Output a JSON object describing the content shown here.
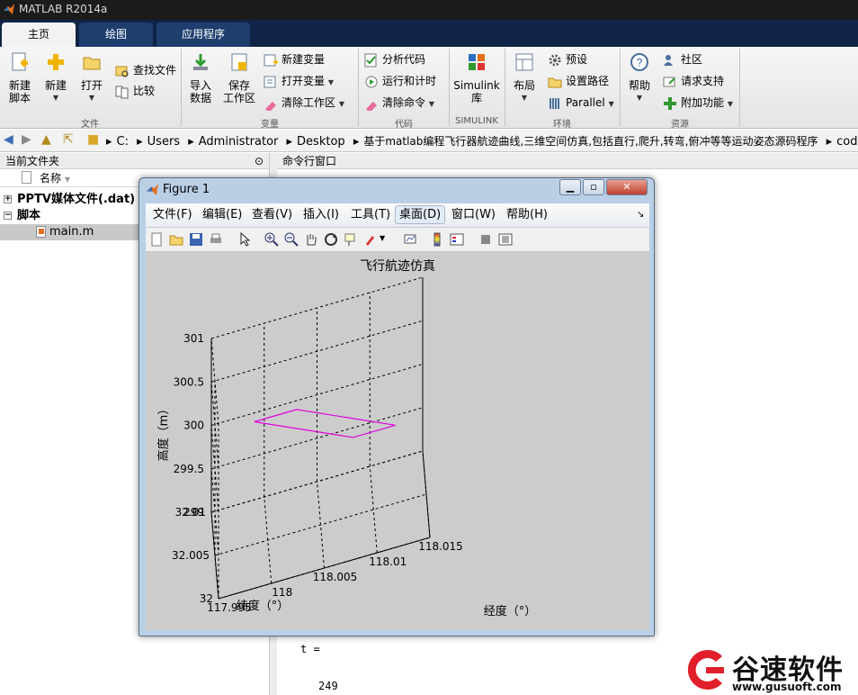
{
  "app": {
    "title": "MATLAB R2014a"
  },
  "tabs": [
    {
      "label": "主页"
    },
    {
      "label": "绘图"
    },
    {
      "label": "应用程序"
    }
  ],
  "ribbon": {
    "file": {
      "new_script": "新建\n脚本",
      "new": "新建",
      "open": "打开",
      "find_files": "查找文件",
      "compare": "比较",
      "group": "文件"
    },
    "variable": {
      "import": "导入\n数据",
      "save_ws": "保存\n工作区",
      "new_var": "新建变量",
      "open_var": "打开变量",
      "clear_ws": "清除工作区",
      "group": "变量"
    },
    "code": {
      "analyze": "分析代码",
      "run_time": "运行和计时",
      "clear_cmd": "清除命令",
      "group": "代码"
    },
    "simulink": {
      "lib": "Simulink\n库",
      "group": "SIMULINK"
    },
    "env": {
      "layout": "布局",
      "prefs": "预设",
      "set_path": "设置路径",
      "parallel": "Parallel",
      "group": "环境"
    },
    "res": {
      "help": "帮助",
      "community": "社区",
      "support": "请求支持",
      "addons": "附加功能",
      "group": "资源"
    }
  },
  "address": {
    "crumbs": [
      "C:",
      "Users",
      "Administrator",
      "Desktop",
      "基于matlab编程飞行器航迹曲线,三维空间仿真,包括直行,爬升,转弯,俯冲等等运动姿态源码程序",
      "code"
    ]
  },
  "left_panel": {
    "title": "当前文件夹",
    "col_name": "名称",
    "items": [
      {
        "label": "PPTV媒体文件(.dat)"
      },
      {
        "label": "脚本"
      },
      {
        "label": "main.m"
      }
    ]
  },
  "command": {
    "title": "命令行窗口",
    "line1": "t =",
    "line2": "249"
  },
  "figure": {
    "title": "Figure 1",
    "menu": [
      "文件(F)",
      "编辑(E)",
      "查看(V)",
      "插入(I)",
      "工具(T)",
      "桌面(D)",
      "窗口(W)",
      "帮助(H)"
    ]
  },
  "chart_data": {
    "type": "line",
    "title": "飞行航迹仿真",
    "xlabel": "经度（°）",
    "ylabel": "纬度（°）",
    "zlabel": "高度（m）",
    "xlim": [
      117.995,
      118.015
    ],
    "ylim": [
      32,
      32.01
    ],
    "zlim": [
      299,
      301
    ],
    "xticks": [
      "117.995",
      "118",
      "118.005",
      "118.01",
      "118.015"
    ],
    "yticks": [
      "32",
      "32.005",
      "32.01"
    ],
    "zticks": [
      "299",
      "299.5",
      "300",
      "300.5",
      "301"
    ],
    "grid": true,
    "series": [
      {
        "color": "#e000e0",
        "x": [
          117.999,
          118.003,
          118.012,
          118.008,
          117.999
        ],
        "y": [
          32.009,
          32.009,
          32.004,
          32.004,
          32.009
        ],
        "z": [
          300,
          300,
          300,
          300,
          300
        ]
      }
    ]
  },
  "watermark": {
    "brand": "谷速软件",
    "url": "www.gusuoft.com"
  }
}
